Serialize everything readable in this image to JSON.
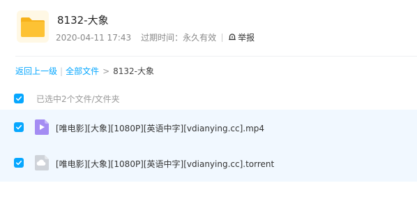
{
  "share": {
    "title": "8132-大象",
    "date": "2020-04-11 17:43",
    "expire_label": "过期时间：",
    "expire_value": "永久有效",
    "report_label": "举报"
  },
  "breadcrumb": {
    "back": "返回上一级",
    "separator": "|",
    "all_files": "全部文件",
    "arrow": ">",
    "current": "8132-大象"
  },
  "selection": {
    "summary": "已选中2个文件/文件夹"
  },
  "files": [
    {
      "name": "[唯电影][大象][1080P][英语中字][vdianying.cc].mp4",
      "icon": "video-file-icon",
      "checked": true
    },
    {
      "name": "[唯电影][大象][1080P][英语中字][vdianying.cc].torrent",
      "icon": "torrent-file-icon",
      "checked": true
    }
  ],
  "colors": {
    "accent": "#06a7ff",
    "row_highlight": "#f1f8ff",
    "folder": "#fdc234",
    "video_icon": "#a48cf3",
    "torrent_icon": "#cfd3d9"
  }
}
